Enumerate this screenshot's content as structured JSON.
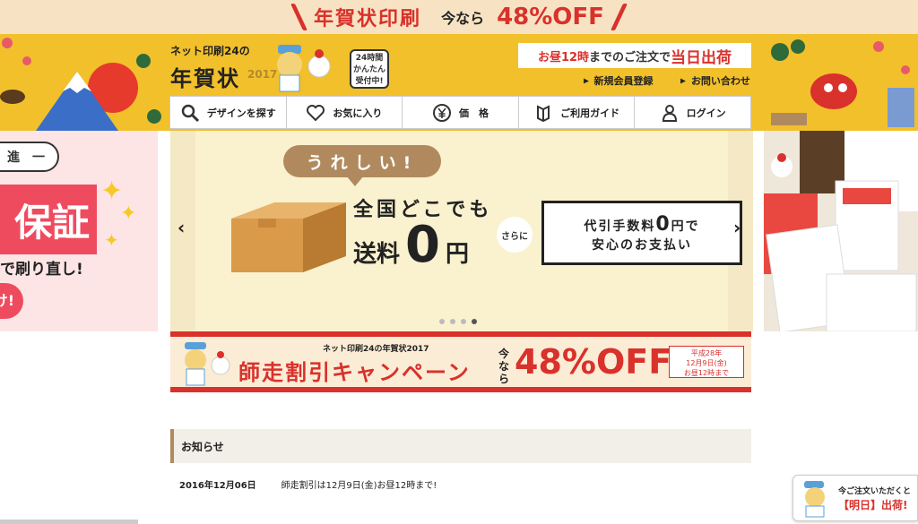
{
  "top_banner": {
    "title": "年賀状印刷",
    "now_label": "今なら",
    "discount": "48%OFF"
  },
  "header": {
    "brand_small": "ネット印刷24の",
    "brand_big": "年賀状",
    "brand_year": "2017",
    "badge": "24時間 かんたん 受付中!",
    "same_day_prefix": "お昼12時",
    "same_day_middle": "までのご注文で",
    "same_day_suffix": "当日出荷",
    "link_register": "新規会員登録",
    "link_contact": "お問い合わせ"
  },
  "nav": [
    {
      "label": "デザインを探す",
      "icon": "search-icon"
    },
    {
      "label": "お気に入り",
      "icon": "heart-icon"
    },
    {
      "label": "価　格",
      "icon": "yen-icon"
    },
    {
      "label": "ご利用ガイド",
      "icon": "guide-icon"
    },
    {
      "label": "ログイン",
      "icon": "user-icon"
    }
  ],
  "left_panel": {
    "pill": "進　一",
    "big": "保証",
    "redo": "で刷り直し!",
    "circle": "け!"
  },
  "slider": {
    "bubble": "うれしい!",
    "line1": "全国どこでも",
    "free_prefix": "送料",
    "free_zero": "0",
    "free_suffix": "円",
    "sarani": "さらに",
    "fee_line1_a": "代引手数料",
    "fee_line1_zero": "0",
    "fee_line1_b": "円で",
    "fee_line2": "安心のお支払い",
    "prev": "‹",
    "next": "›",
    "dots": 4,
    "active_dot": 4
  },
  "campaign": {
    "mini": "ネット印刷24の年賀状2017",
    "title": "師走割引キャンペーン",
    "now": "今なら",
    "discount": "48%OFF",
    "date_line1": "平成28年",
    "date_line2": "12月9日(金)",
    "date_line3": "お昼12時まで"
  },
  "news": {
    "heading": "お知らせ",
    "items": [
      {
        "date": "2016年12月06日",
        "text": "師走割引は12月9日(金)お昼12時まで!"
      }
    ]
  },
  "float_badge": {
    "line1": "今ご注文いただくと",
    "line2": "【明日】出荷!"
  },
  "colors": {
    "accent_red": "#d9312b",
    "header_yellow": "#f2c02b"
  }
}
